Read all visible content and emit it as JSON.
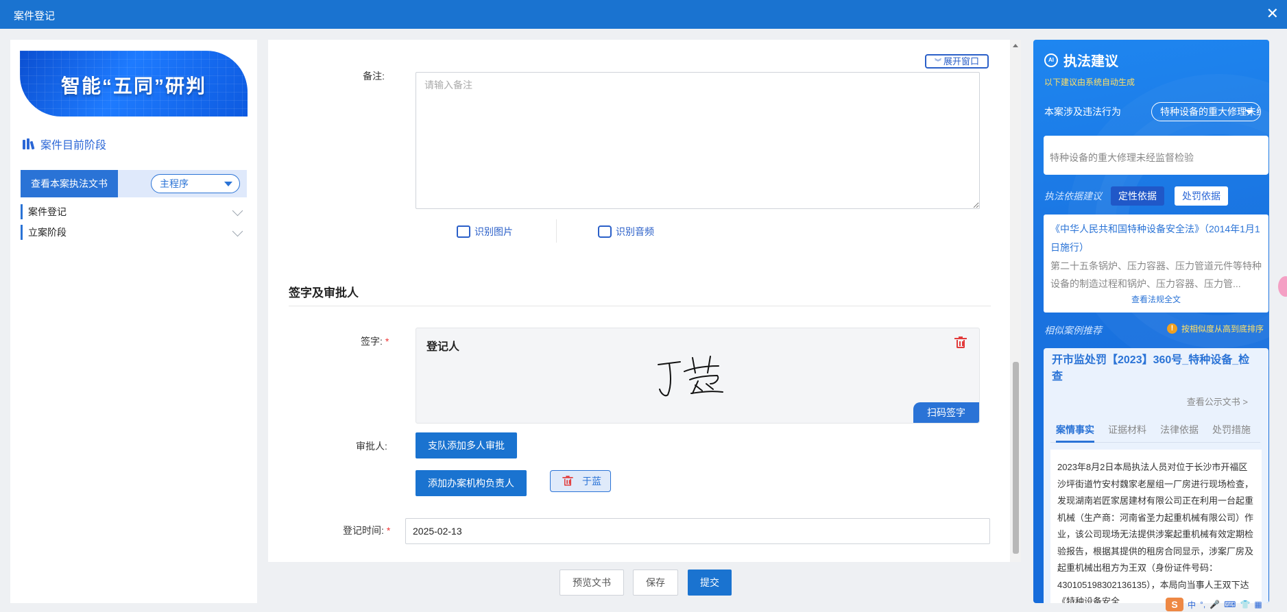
{
  "window": {
    "title": "案件登记",
    "close_icon": "close-icon"
  },
  "left": {
    "banner_text": "智能“五同”研判",
    "stage_title": "案件目前阶段",
    "doc_button": "查看本案执法文书",
    "procedure_select": "主程序",
    "tree": [
      {
        "label": "案件登记"
      },
      {
        "label": "立案阶段"
      }
    ]
  },
  "form": {
    "expand_button": "展开窗口",
    "remark_label": "备注:",
    "remark_placeholder": "请输入备注",
    "recognize_image": "识别图片",
    "recognize_audio": "识别音频",
    "section_title": "签字及审批人",
    "sign_label": "签字:",
    "required_mark": "*",
    "signer_role": "登记人",
    "signature_name": "于蓝",
    "scan_sign_button": "扫码签字",
    "approver_label": "审批人:",
    "add_multi_approval": "支队添加多人审批",
    "add_org_head": "添加办案机构负责人",
    "approver_tag": "于蓝",
    "reg_time_label": "登记时间:",
    "reg_time_value": "2025-02-13"
  },
  "footer": {
    "preview": "预览文书",
    "save": "保存",
    "submit": "提交"
  },
  "advice": {
    "title": "执法建议",
    "ai_badge": "AI",
    "subtitle": "以下建议由系统自动生成",
    "violation_label": "本案涉及违法行为",
    "violation_select": "特种设备的重大修理未经",
    "violation_text": "特种设备的重大修理未经监督检验",
    "basis_label": "执法依据建议",
    "tab_qualitative": "定性依据",
    "tab_penalty": "处罚依据",
    "law_title": "《中华人民共和国特种设备安全法》（2014年1月1日施行）",
    "law_text": "第二十五条锅炉、压力容器、压力管道元件等特种设备的制造过程和锅炉、压力容器、压力管...",
    "law_link": "查看法规全文",
    "similar_label": "相似案例推荐",
    "sort_hint": "按相似度从高到底排序",
    "case_title": "开市监处罚【2023】360号_特种设备_检查",
    "case_link": "查看公示文书 >",
    "case_tabs": [
      "案情事实",
      "证据材料",
      "法律依据",
      "处罚措施"
    ],
    "case_text": "2023年8月2日本局执法人员对位于长沙市开福区沙坪街道竹安村魏家老屋组一厂房进行现场检查，发现湖南岩匠家居建材有限公司正在利用一台起重机械（生产商：河南省圣力起重机械有限公司）作业，该公司现场无法提供涉案起重机械有效定期检验报告，根据其提供的租房合同显示，涉案厂房及起重机械出租方为王双（身份证件号码：430105198302136135），本局向当事人王双下达《特种设备安全"
  },
  "ime": {
    "char": "中"
  },
  "colors": {
    "primary": "#1a73d0",
    "accent_yellow": "#ffe066",
    "danger": "#e23b3b"
  }
}
